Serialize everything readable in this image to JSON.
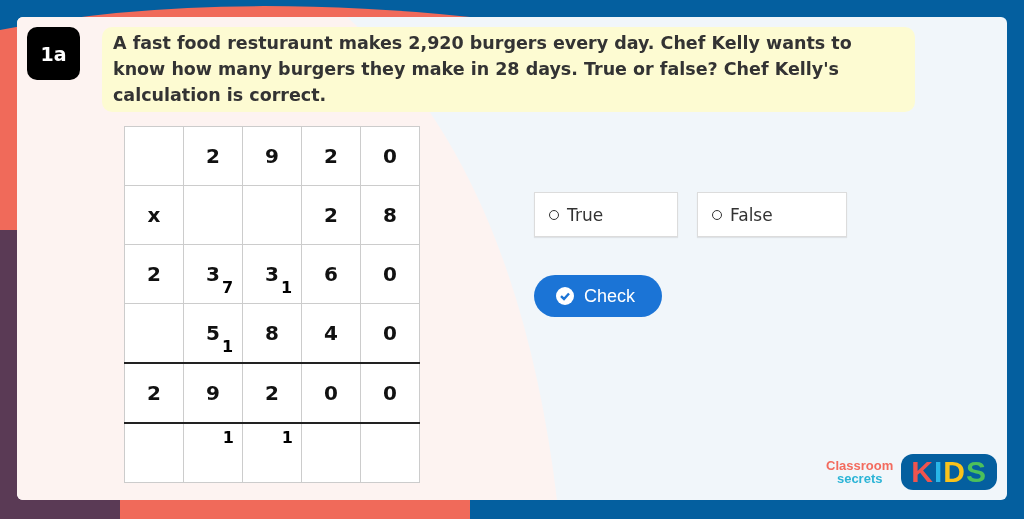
{
  "question": {
    "number": "1a",
    "text": "A fast food resturaunt makes 2,920 burgers every day. Chef Kelly wants to know how many burgers they make in 28 days. True or false? Chef Kelly's calculation is correct."
  },
  "grid": {
    "rows": [
      {
        "rule_above": false,
        "cells": [
          {},
          {
            "value": "2"
          },
          {
            "value": "9"
          },
          {
            "value": "2"
          },
          {
            "value": "0"
          }
        ]
      },
      {
        "rule_above": false,
        "cells": [
          {
            "value": "x"
          },
          {},
          {},
          {
            "value": "2"
          },
          {
            "value": "8"
          }
        ]
      },
      {
        "rule_above": false,
        "cells": [
          {
            "value": "2"
          },
          {
            "value": "3",
            "carry": "7"
          },
          {
            "value": "3",
            "carry": "1"
          },
          {
            "value": "6"
          },
          {
            "value": "0"
          }
        ]
      },
      {
        "rule_above": false,
        "cells": [
          {},
          {
            "value": "5",
            "carry": "1"
          },
          {
            "value": "8"
          },
          {
            "value": "4"
          },
          {
            "value": "0"
          }
        ]
      },
      {
        "rule_above": true,
        "cells": [
          {
            "value": "2"
          },
          {
            "value": "9"
          },
          {
            "value": "2"
          },
          {
            "value": "0"
          },
          {
            "value": "0"
          }
        ]
      },
      {
        "rule_above": true,
        "cells": [
          {},
          {
            "top_carry": "1"
          },
          {
            "top_carry": "1"
          },
          {},
          {}
        ]
      }
    ]
  },
  "options": [
    {
      "label": "True",
      "selected": false
    },
    {
      "label": "False",
      "selected": false
    }
  ],
  "check_button": "Check",
  "logo": {
    "line_1": "Classroom",
    "line_2": "secrets",
    "badge": "KIDS"
  }
}
